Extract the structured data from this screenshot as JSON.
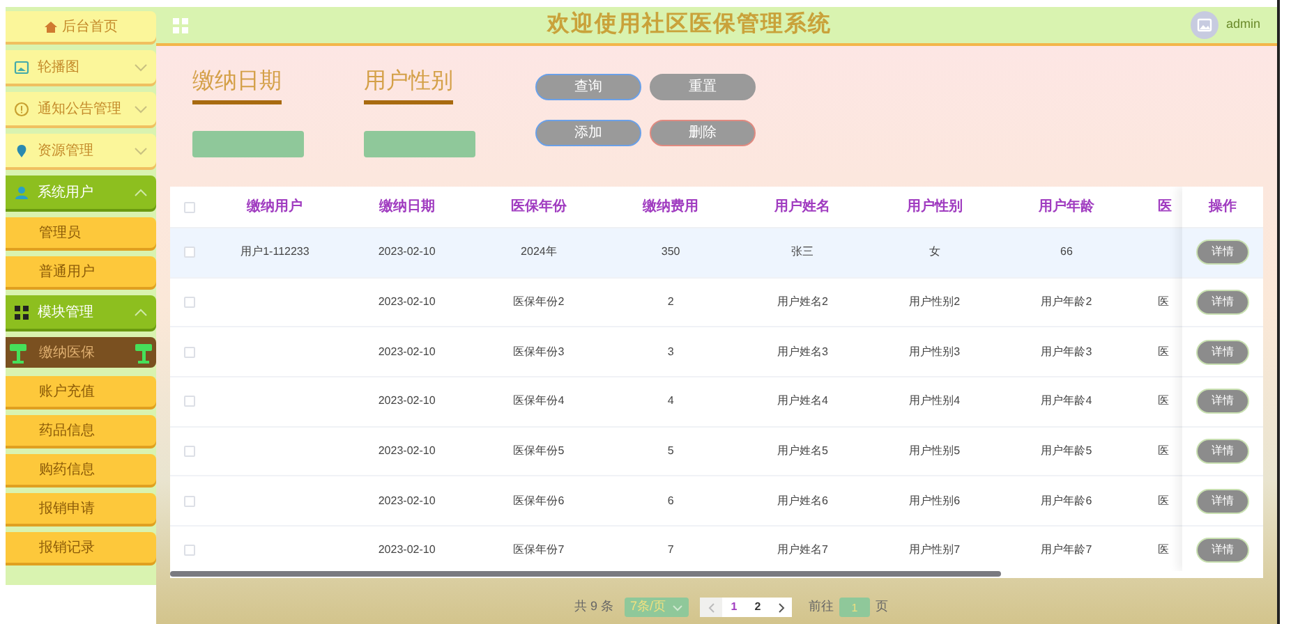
{
  "sidebar": {
    "home": "后台首页",
    "items": [
      {
        "label": "轮播图",
        "expanded": false
      },
      {
        "label": "通知公告管理",
        "expanded": false
      },
      {
        "label": "资源管理",
        "expanded": false
      },
      {
        "label": "系统用户",
        "expanded": true,
        "children": [
          {
            "label": "管理员",
            "selected": false
          },
          {
            "label": "普通用户",
            "selected": false
          }
        ]
      },
      {
        "label": "模块管理",
        "expanded": true,
        "children": [
          {
            "label": "缴纳医保",
            "selected": true
          },
          {
            "label": "账户充值",
            "selected": false
          },
          {
            "label": "药品信息",
            "selected": false
          },
          {
            "label": "购药信息",
            "selected": false
          },
          {
            "label": "报销申请",
            "selected": false
          },
          {
            "label": "报销记录",
            "selected": false
          }
        ]
      }
    ]
  },
  "header": {
    "title": "欢迎使用社区医保管理系统",
    "user": "admin"
  },
  "search": {
    "fields": [
      {
        "label": "缴纳日期"
      },
      {
        "label": "用户性别"
      }
    ],
    "buttons": [
      {
        "label": "查询",
        "kind": "primary"
      },
      {
        "label": "重置",
        "kind": "plain"
      },
      {
        "label": "添加",
        "kind": "primary"
      },
      {
        "label": "删除",
        "kind": "danger"
      }
    ]
  },
  "table": {
    "columns": [
      "缴纳用户",
      "缴纳日期",
      "医保年份",
      "缴纳费用",
      "用户姓名",
      "用户性别",
      "用户年龄",
      "医"
    ],
    "action_column": "操作",
    "all_checked": false,
    "rows": [
      {
        "checked": false,
        "hovered": true,
        "cells": [
          "用户1-112233",
          "2023-02-10",
          "2024年",
          "350",
          "张三",
          "女",
          "66",
          ""
        ],
        "action": "详情"
      },
      {
        "checked": false,
        "hovered": false,
        "cells": [
          "",
          "2023-02-10",
          "医保年份2",
          "2",
          "用户姓名2",
          "用户性别2",
          "用户年龄2",
          "医"
        ],
        "action": "详情"
      },
      {
        "checked": false,
        "hovered": false,
        "cells": [
          "",
          "2023-02-10",
          "医保年份3",
          "3",
          "用户姓名3",
          "用户性别3",
          "用户年龄3",
          "医"
        ],
        "action": "详情"
      },
      {
        "checked": false,
        "hovered": false,
        "cells": [
          "",
          "2023-02-10",
          "医保年份4",
          "4",
          "用户姓名4",
          "用户性别4",
          "用户年龄4",
          "医"
        ],
        "action": "详情"
      },
      {
        "checked": false,
        "hovered": false,
        "cells": [
          "",
          "2023-02-10",
          "医保年份5",
          "5",
          "用户姓名5",
          "用户性别5",
          "用户年龄5",
          "医"
        ],
        "action": "详情"
      },
      {
        "checked": false,
        "hovered": false,
        "cells": [
          "",
          "2023-02-10",
          "医保年份6",
          "6",
          "用户姓名6",
          "用户性别6",
          "用户年龄6",
          "医"
        ],
        "action": "详情"
      },
      {
        "checked": false,
        "hovered": false,
        "cells": [
          "",
          "2023-02-10",
          "医保年份7",
          "7",
          "用户姓名7",
          "用户性别7",
          "用户年龄7",
          "医"
        ],
        "action": "详情"
      }
    ]
  },
  "pagination": {
    "total": "共 9 条",
    "page_size": "7条/页",
    "pages": [
      {
        "label": "1",
        "selected": true
      },
      {
        "label": "2",
        "selected": false
      }
    ],
    "goto_label": "前往",
    "goto_value": "1",
    "goto_suffix": "页"
  }
}
